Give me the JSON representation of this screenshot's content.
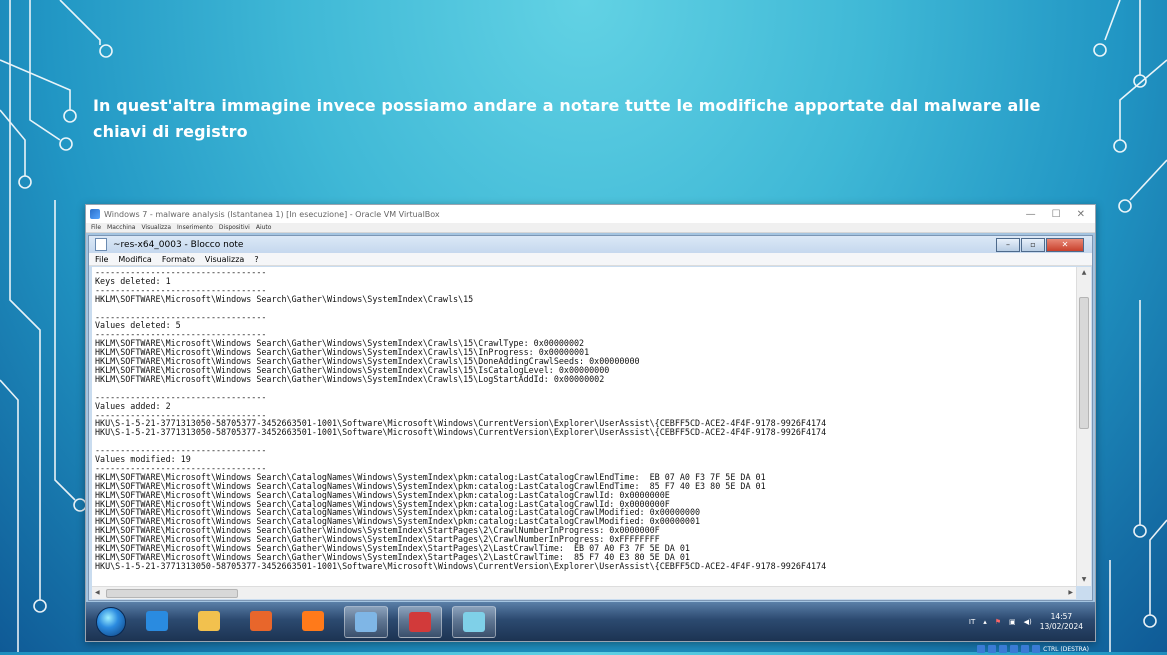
{
  "caption": "In quest'altra immagine invece possiamo andare a notare tutte le modifiche apportate dal malware alle chiavi di registro",
  "vbox": {
    "title": "Windows 7 - malware analysis (Istantanea 1) [In esecuzione] - Oracle VM VirtualBox",
    "menu": [
      "File",
      "Macchina",
      "Visualizza",
      "Inserimento",
      "Dispositivi",
      "Aiuto"
    ],
    "controls": [
      "—",
      "☐",
      "✕"
    ]
  },
  "notepad": {
    "title": "~res-x64_0003 - Blocco note",
    "menu": [
      "File",
      "Modifica",
      "Formato",
      "Visualizza",
      "?"
    ],
    "lines": [
      "----------------------------------",
      "Keys deleted: 1",
      "----------------------------------",
      "HKLM\\SOFTWARE\\Microsoft\\Windows Search\\Gather\\Windows\\SystemIndex\\Crawls\\15",
      "",
      "----------------------------------",
      "Values deleted: 5",
      "----------------------------------",
      "HKLM\\SOFTWARE\\Microsoft\\Windows Search\\Gather\\Windows\\SystemIndex\\Crawls\\15\\CrawlType: 0x00000002",
      "HKLM\\SOFTWARE\\Microsoft\\Windows Search\\Gather\\Windows\\SystemIndex\\Crawls\\15\\InProgress: 0x00000001",
      "HKLM\\SOFTWARE\\Microsoft\\Windows Search\\Gather\\Windows\\SystemIndex\\Crawls\\15\\DoneAddingCrawlSeeds: 0x00000000",
      "HKLM\\SOFTWARE\\Microsoft\\Windows Search\\Gather\\Windows\\SystemIndex\\Crawls\\15\\IsCatalogLevel: 0x00000000",
      "HKLM\\SOFTWARE\\Microsoft\\Windows Search\\Gather\\Windows\\SystemIndex\\Crawls\\15\\LogStartAddId: 0x00000002",
      "",
      "----------------------------------",
      "Values added: 2",
      "----------------------------------",
      "HKU\\S-1-5-21-3771313050-58705377-3452663501-1001\\Software\\Microsoft\\Windows\\CurrentVersion\\Explorer\\UserAssist\\{CEBFF5CD-ACE2-4F4F-9178-9926F4174",
      "HKU\\S-1-5-21-3771313050-58705377-3452663501-1001\\Software\\Microsoft\\Windows\\CurrentVersion\\Explorer\\UserAssist\\{CEBFF5CD-ACE2-4F4F-9178-9926F4174",
      "",
      "----------------------------------",
      "Values modified: 19",
      "----------------------------------",
      "HKLM\\SOFTWARE\\Microsoft\\Windows Search\\CatalogNames\\Windows\\SystemIndex\\pkm:catalog:LastCatalogCrawlEndTime:  EB 07 A0 F3 7F 5E DA 01",
      "HKLM\\SOFTWARE\\Microsoft\\Windows Search\\CatalogNames\\Windows\\SystemIndex\\pkm:catalog:LastCatalogCrawlEndTime:  85 F7 40 E3 80 5E DA 01",
      "HKLM\\SOFTWARE\\Microsoft\\Windows Search\\CatalogNames\\Windows\\SystemIndex\\pkm:catalog:LastCatalogCrawlId: 0x0000000E",
      "HKLM\\SOFTWARE\\Microsoft\\Windows Search\\CatalogNames\\Windows\\SystemIndex\\pkm:catalog:LastCatalogCrawlId: 0x0000000F",
      "HKLM\\SOFTWARE\\Microsoft\\Windows Search\\CatalogNames\\Windows\\SystemIndex\\pkm:catalog:LastCatalogCrawlModified: 0x00000000",
      "HKLM\\SOFTWARE\\Microsoft\\Windows Search\\CatalogNames\\Windows\\SystemIndex\\pkm:catalog:LastCatalogCrawlModified: 0x00000001",
      "HKLM\\SOFTWARE\\Microsoft\\Windows Search\\Gather\\Windows\\SystemIndex\\StartPages\\2\\CrawlNumberInProgress: 0x0000000F",
      "HKLM\\SOFTWARE\\Microsoft\\Windows Search\\Gather\\Windows\\SystemIndex\\StartPages\\2\\CrawlNumberInProgress: 0xFFFFFFFF",
      "HKLM\\SOFTWARE\\Microsoft\\Windows Search\\Gather\\Windows\\SystemIndex\\StartPages\\2\\LastCrawlTime:  EB 07 A0 F3 7F 5E DA 01",
      "HKLM\\SOFTWARE\\Microsoft\\Windows Search\\Gather\\Windows\\SystemIndex\\StartPages\\2\\LastCrawlTime:  85 F7 40 E3 80 5E DA 01",
      "HKU\\S-1-5-21-3771313050-58705377-3452663501-1001\\Software\\Microsoft\\Windows\\CurrentVersion\\Explorer\\UserAssist\\{CEBFF5CD-ACE2-4F4F-9178-9926F4174"
    ]
  },
  "taskbar": {
    "apps": [
      {
        "icon": "internet-explorer-icon",
        "color": "#2a8be0"
      },
      {
        "icon": "file-explorer-icon",
        "color": "#f2c14e"
      },
      {
        "icon": "media-player-icon",
        "color": "#e8662b"
      },
      {
        "icon": "firefox-icon",
        "color": "#ff7a1a"
      },
      {
        "icon": "process-monitor-icon",
        "color": "#7fb6e6"
      },
      {
        "icon": "regshot-icon",
        "color": "#d23a3a"
      },
      {
        "icon": "notepad-icon",
        "color": "#7fd0e8"
      }
    ],
    "lang": "IT",
    "time": "14:57",
    "date": "13/02/2024",
    "host_key": "CTRL (DESTRA)"
  }
}
